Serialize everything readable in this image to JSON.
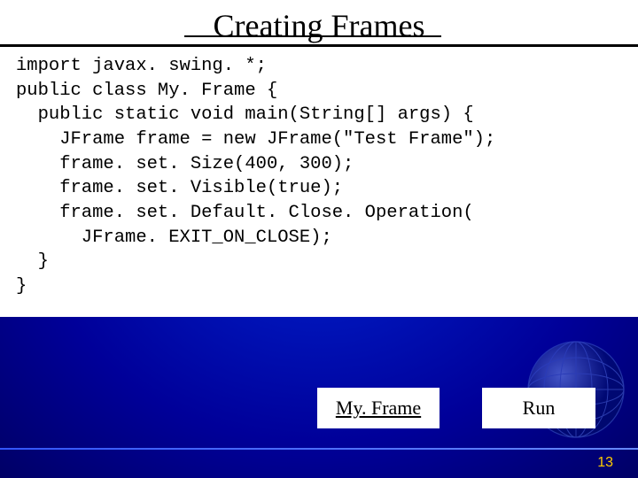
{
  "slide": {
    "title": "Creating Frames",
    "page_number": "13"
  },
  "code": {
    "line1": "import javax. swing. *;",
    "line2": "public class My. Frame {",
    "line3": "  public static void main(String[] args) {",
    "line4": "    JFrame frame = new JFrame(\"Test Frame\");",
    "line5": "    frame. set. Size(400, 300);",
    "line6": "    frame. set. Visible(true);",
    "line7": "    frame. set. Default. Close. Operation(",
    "line8": "      JFrame. EXIT_ON_CLOSE);",
    "line9": "  }",
    "line10": "}"
  },
  "buttons": {
    "myframe_label": "My. Frame",
    "run_label": "Run"
  }
}
